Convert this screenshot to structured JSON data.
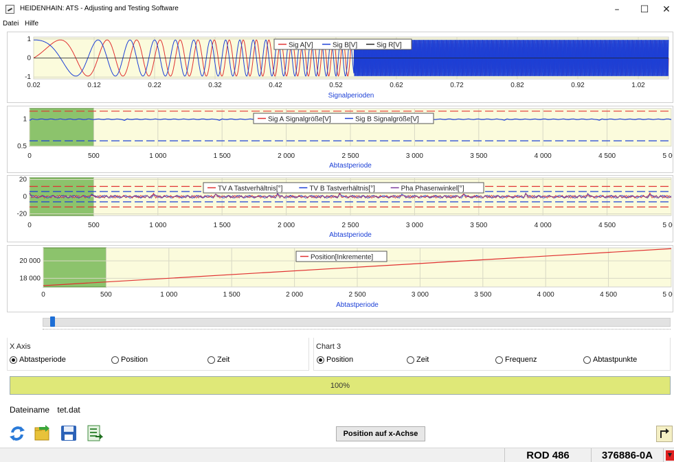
{
  "window": {
    "title": "HEIDENHAIN: ATS - Adjusting and Testing Software",
    "controls": {
      "minimize": "–",
      "maximize": "☐",
      "close": "✕"
    }
  },
  "menu": {
    "items": [
      "Datei",
      "Hilfe"
    ]
  },
  "chart_data": [
    {
      "type": "line",
      "xlabel": "Signalperioden",
      "xticks": [
        "0.02",
        "0.12",
        "0.22",
        "0.32",
        "0.42",
        "0.52",
        "0.62",
        "0.72",
        "0.82",
        "0.92",
        "1.02"
      ],
      "yticks": [
        "1",
        "0",
        "-1"
      ],
      "xlim": [
        0.02,
        1.07
      ],
      "ylim": [
        -1.1,
        1.1
      ],
      "legend": [
        "Sig A[V]",
        "Sig B[V]",
        "Sig R[V]"
      ],
      "colors": [
        "#e03030",
        "#1b3fd6",
        "#222222"
      ],
      "chirp_end": 0.55
    },
    {
      "type": "line",
      "xlabel": "Abtastperiode",
      "xticks": [
        "0",
        "500",
        "1 000",
        "1 500",
        "2 000",
        "2 500",
        "3 000",
        "3 500",
        "4 000",
        "4 500",
        "5 000"
      ],
      "yticks": [
        "1",
        "0.5"
      ],
      "xlim": [
        0,
        5000
      ],
      "ylim": [
        0.5,
        1.2
      ],
      "legend": [
        "Sig A Signalgröße[V]",
        "Sig B Signalgröße[V]"
      ],
      "colors": [
        "#e03030",
        "#1b3fd6"
      ],
      "limits_red": [
        1.15
      ],
      "limits_blue": [
        0.6
      ],
      "signal_level": 1.0,
      "highlight": [
        0,
        500
      ]
    },
    {
      "type": "line",
      "xlabel": "Abtastperiode",
      "xticks": [
        "0",
        "500",
        "1 000",
        "1 500",
        "2 000",
        "2 500",
        "3 000",
        "3 500",
        "4 000",
        "4 500",
        "5 000"
      ],
      "yticks": [
        "20",
        "0",
        "-20"
      ],
      "xlim": [
        0,
        5000
      ],
      "ylim": [
        -22,
        22
      ],
      "legend": [
        "TV A Tastverhältnis[°]",
        "TV B Tastverhältnis[°]",
        "Pha Phasenwinkel[°]"
      ],
      "colors": [
        "#e03030",
        "#1b3fd6",
        "#7a3a9a"
      ],
      "limits_red": [
        12,
        -12
      ],
      "limits_blue": [
        6,
        -6
      ],
      "highlight": [
        0,
        500
      ]
    },
    {
      "type": "line",
      "xlabel": "Abtastperiode",
      "xticks": [
        "0",
        "500",
        "1 000",
        "1 500",
        "2 000",
        "2 500",
        "3 000",
        "3 500",
        "4 000",
        "4 500",
        "5 000"
      ],
      "yticks": [
        "20 000",
        "18 000"
      ],
      "xlim": [
        0,
        5000
      ],
      "ylim": [
        17000,
        21500
      ],
      "legend": [
        "Position[Inkremente]"
      ],
      "colors": [
        "#e03030"
      ],
      "series": [
        {
          "name": "Position[Inkremente]",
          "x": [
            0,
            5000
          ],
          "y": [
            17150,
            21400
          ]
        }
      ],
      "highlight": [
        0,
        500
      ]
    }
  ],
  "x_axis_group": {
    "title": "X Axis",
    "options": [
      {
        "label": "Abtastperiode",
        "selected": true
      },
      {
        "label": "Position",
        "selected": false
      },
      {
        "label": "Zeit",
        "selected": false
      }
    ]
  },
  "chart3_group": {
    "title": "Chart 3",
    "options": [
      {
        "label": "Position",
        "selected": true
      },
      {
        "label": "Zeit",
        "selected": false
      },
      {
        "label": "Frequenz",
        "selected": false
      },
      {
        "label": "Abtastpunkte",
        "selected": false
      }
    ]
  },
  "progress": {
    "value": 1.0,
    "label": "100%"
  },
  "file": {
    "label": "Dateiname",
    "name": "tet.dat"
  },
  "toolbar": {
    "icons": [
      "refresh-icon",
      "open-folder-icon",
      "save-icon",
      "export-icon"
    ],
    "position_button": "Position auf x-Achse",
    "back_icon": "back-arrow-icon"
  },
  "status": {
    "model": "ROD 486",
    "id": "376886-0A"
  },
  "colors": {
    "plot_bg": "#fbfbdc",
    "highlight": "#8cc36c",
    "progress": "#dfe878"
  }
}
